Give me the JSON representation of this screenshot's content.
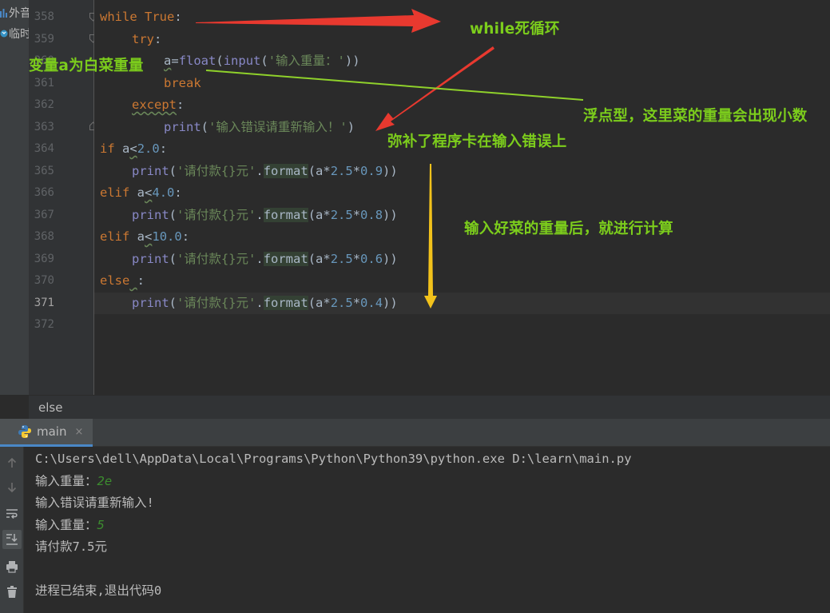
{
  "project_panel": {
    "items": [
      {
        "label": "外音"
      },
      {
        "label": "临时"
      }
    ]
  },
  "gutter": {
    "line_numbers": [
      "358",
      "359",
      "360",
      "361",
      "362",
      "363",
      "364",
      "365",
      "366",
      "367",
      "368",
      "369",
      "370",
      "371",
      "372"
    ],
    "current_line": "371"
  },
  "code": {
    "line_358": {
      "kw": "while",
      "val": "True",
      "colon": ":"
    },
    "line_359": {
      "kw": "try",
      "colon": ":"
    },
    "line_360": {
      "var": "a",
      "eq": "=",
      "fn1": "float",
      "p1": "(",
      "fn2": "input",
      "p2": "(",
      "str": "'输入重量：'",
      "close": "))"
    },
    "line_361": {
      "kw": "break"
    },
    "line_362": {
      "kw": "except",
      "colon": ":"
    },
    "line_363": {
      "fn": "print",
      "p": "(",
      "str": "'输入错误请重新输入！'",
      "close": ")"
    },
    "line_364": {
      "kw": "if",
      "var": "a",
      "op": "<",
      "num": "2.0",
      "colon": ":"
    },
    "line_365": {
      "fn": "print",
      "p": "(",
      "str": "'请付款{}元'",
      "dot": ".",
      "method": "format",
      "args_open": "(a*",
      "n1": "2.5",
      "star": "*",
      "n2": "0.9",
      "args_close": "))"
    },
    "line_366": {
      "kw": "elif",
      "var": "a",
      "op": "<",
      "num": "4.0",
      "colon": ":"
    },
    "line_367": {
      "fn": "print",
      "p": "(",
      "str": "'请付款{}元'",
      "dot": ".",
      "method": "format",
      "args_open": "(a*",
      "n1": "2.5",
      "star": "*",
      "n2": "0.8",
      "args_close": "))"
    },
    "line_368": {
      "kw": "elif",
      "var": "a",
      "op": "<",
      "num": "10.0",
      "colon": ":"
    },
    "line_369": {
      "fn": "print",
      "p": "(",
      "str": "'请付款{}元'",
      "dot": ".",
      "method": "format",
      "args_open": "(a*",
      "n1": "2.5",
      "star": "*",
      "n2": "0.6",
      "args_close": "))"
    },
    "line_370": {
      "kw": "else",
      "space": " ",
      "colon": ":"
    },
    "line_371": {
      "fn": "print",
      "p": "(",
      "str": "'请付款{}元'",
      "dot": ".",
      "method": "format",
      "args_open": "(a*",
      "n1": "2.5",
      "star": "*",
      "n2": "0.4",
      "args_close": "))"
    }
  },
  "breadcrumb": {
    "label": "else"
  },
  "run_panel": {
    "tab_label": "main",
    "tab_close": "×"
  },
  "console": {
    "command": "C:\\Users\\dell\\AppData\\Local\\Programs\\Python\\Python39\\python.exe D:\\learn\\main.py",
    "prompt1": "输入重量：",
    "input1": "2e",
    "error_msg": "输入错误请重新输入!",
    "prompt2": "输入重量：",
    "input2": "5",
    "result": "请付款7.5元",
    "exit_msg": "进程已结束,退出代码0"
  },
  "annotations": {
    "while_loop": "while死循环",
    "variable_a": "变量a为白菜重量",
    "float_note": "浮点型，这里菜的重量会出现小数",
    "error_note": "弥补了程序卡在输入错误上",
    "compute_note": "输入好菜的重量后，就进行计算"
  },
  "colors": {
    "keyword": "#cc7832",
    "string": "#6a8759",
    "number": "#6897bb",
    "builtin": "#8888c6",
    "annotation_text": "#7ccd1c",
    "arrow_red": "#e8392f",
    "arrow_green": "#8fd12b",
    "arrow_yellow": "#f2c21b"
  },
  "icons": {
    "run_tab": "python-icon",
    "tools": [
      "arrow-up-icon",
      "arrow-down-icon",
      "soft-wrap-icon",
      "scroll-to-end-icon",
      "print-icon",
      "trash-icon"
    ]
  }
}
